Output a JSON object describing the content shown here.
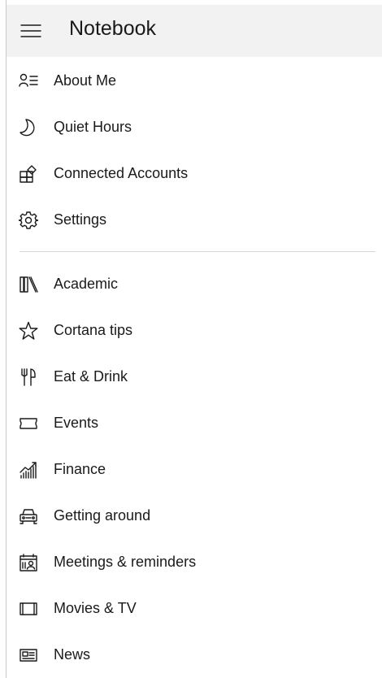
{
  "header": {
    "title": "Notebook",
    "menu_icon": "hamburger-icon"
  },
  "menu_top": [
    {
      "label": "About Me",
      "icon": "about-me-icon"
    },
    {
      "label": "Quiet Hours",
      "icon": "moon-icon"
    },
    {
      "label": "Connected Accounts",
      "icon": "connected-accounts-icon"
    },
    {
      "label": "Settings",
      "icon": "gear-icon"
    }
  ],
  "menu_bottom": [
    {
      "label": "Academic",
      "icon": "books-icon"
    },
    {
      "label": "Cortana tips",
      "icon": "star-icon"
    },
    {
      "label": "Eat & Drink",
      "icon": "fork-knife-icon"
    },
    {
      "label": "Events",
      "icon": "ticket-icon"
    },
    {
      "label": "Finance",
      "icon": "chart-icon"
    },
    {
      "label": "Getting around",
      "icon": "car-icon"
    },
    {
      "label": "Meetings & reminders",
      "icon": "calendar-person-icon"
    },
    {
      "label": "Movies & TV",
      "icon": "film-icon"
    },
    {
      "label": "News",
      "icon": "newspaper-icon"
    }
  ]
}
